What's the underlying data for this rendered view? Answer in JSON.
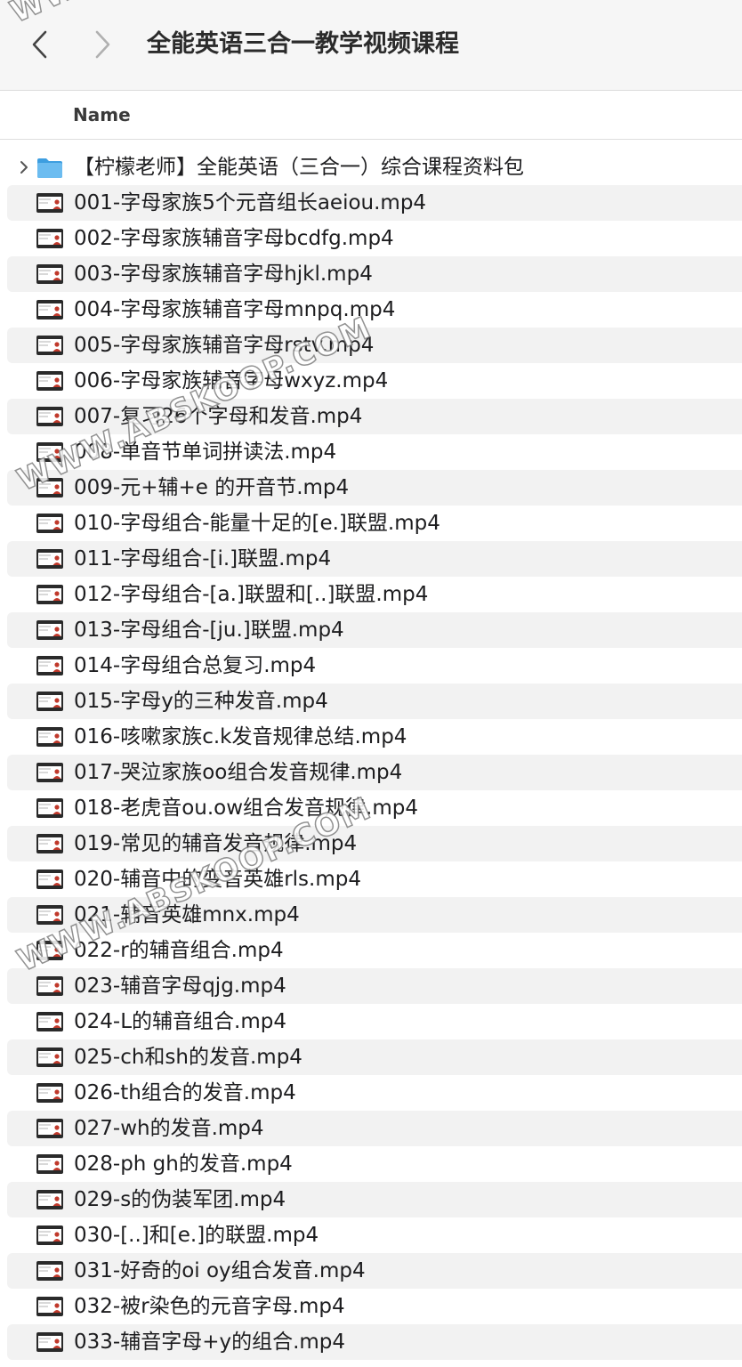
{
  "window": {
    "title": "全能英语三合一教学视频课程"
  },
  "header": {
    "column_name": "Name"
  },
  "folder": {
    "name": "【柠檬老师】全能英语（三合一）综合课程资料包",
    "icon": "folder-icon",
    "color": "#5ab0e8"
  },
  "files": [
    "001-字母家族5个元音组长aeiou.mp4",
    "002-字母家族辅音字母bcdfg.mp4",
    "003-字母家族辅音字母hjkl.mp4",
    "004-字母家族辅音字母mnpq.mp4",
    "005-字母家族辅音字母rstv.mp4",
    "006-字母家族辅音字母wxyz.mp4",
    "007-复习26个字母和发音.mp4",
    "008-单音节单词拼读法.mp4",
    "009-元+辅+e 的开音节.mp4",
    "010-字母组合-能量十足的[e.]联盟.mp4",
    "011-字母组合-[i.]联盟.mp4",
    "012-字母组合-[a.]联盟和[..]联盟.mp4",
    "013-字母组合-[ju.]联盟.mp4",
    "014-字母组合总复习.mp4",
    "015-字母y的三种发音.mp4",
    "016-咳嗽家族c.k发音规律总结.mp4",
    "017-哭泣家族oo组合发音规律.mp4",
    "018-老虎音ou.ow组合发音规律.mp4",
    "019-常见的辅音发音规律.mp4",
    "020-辅音中的变音英雄rls.mp4",
    "021-辅音英雄mnx.mp4",
    "022-r的辅音组合.mp4",
    "023-辅音字母qjg.mp4",
    "024-L的辅音组合.mp4",
    "025-ch和sh的发音.mp4",
    "026-th组合的发音.mp4",
    "027-wh的发音.mp4",
    "028-ph gh的发音.mp4",
    "029-s的伪装军团.mp4",
    "030-[..]和[e.]的联盟.mp4",
    "031-好奇的oi oy组合发音.mp4",
    "032-被r染色的元音字母.mp4",
    "033-辅音字母+y的组合.mp4"
  ],
  "watermarks": [
    "WWW.ABSKOOP.COM",
    "WWW.ABSKOOP.COM",
    "WWW"
  ],
  "colors": {
    "row_alt": "#f2f2f2",
    "title_bar": "#f6f6f6",
    "video_icon_accent": "#c0392b"
  }
}
